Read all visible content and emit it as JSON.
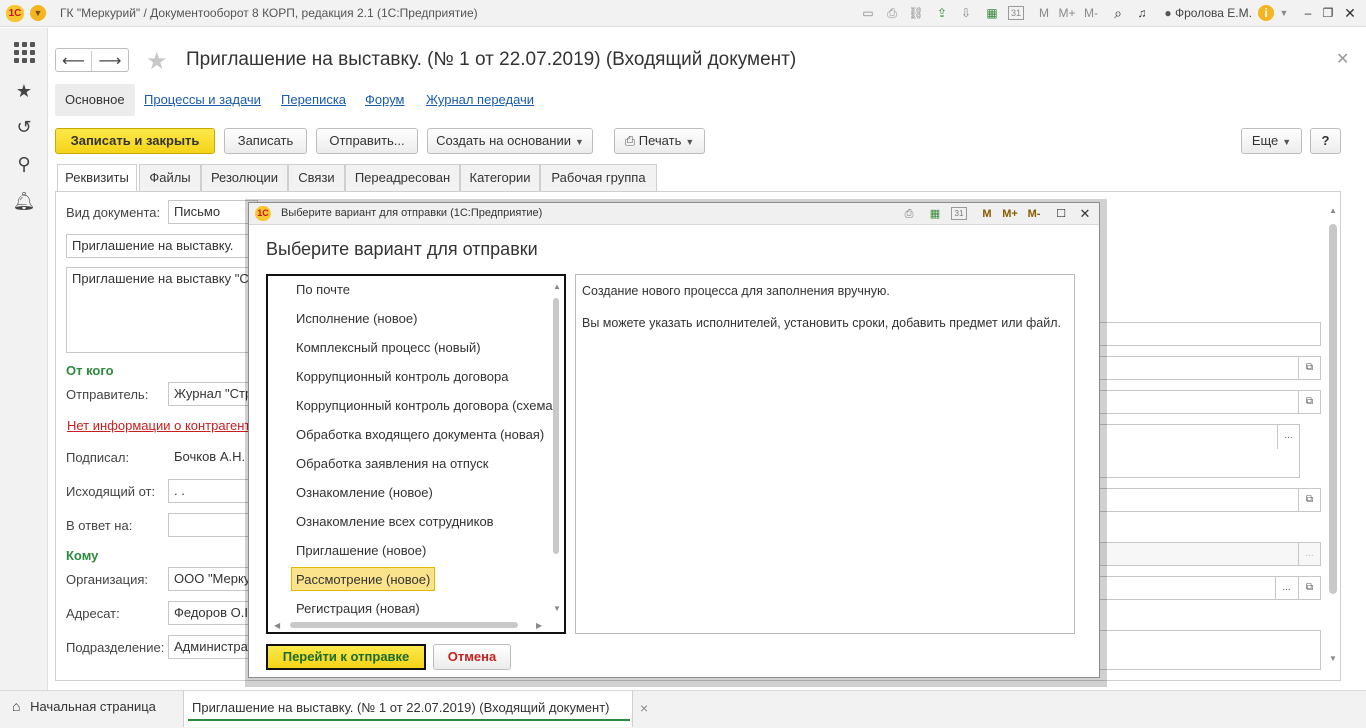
{
  "titlebar": {
    "logo": "1С",
    "title": "ГК \"Меркурий\" / Документооборот 8 КОРП, редакция 2.1  (1С:Предприятие)",
    "user": "Фролова Е.М.",
    "icons": [
      "save-icon",
      "print-icon",
      "link-icon",
      "upload-icon",
      "download-icon",
      "calculator-icon",
      "calendar-icon",
      "memory-m-icon",
      "memory-plus-icon",
      "memory-minus-icon",
      "search-icon",
      "bell-icon",
      "info-icon",
      "minimize-icon",
      "restore-icon",
      "close-icon"
    ],
    "calendar_day": "31",
    "m": "M",
    "mplus": "M+",
    "mminus": "M-"
  },
  "sidebar": {
    "icons": [
      "apps-grid-icon",
      "favorites-star-icon",
      "history-icon",
      "search-icon",
      "notifications-bell-icon"
    ]
  },
  "form": {
    "title": "Приглашение на выставку. (№ 1 от 22.07.2019) (Входящий документ)",
    "nav": {
      "main": "Основное",
      "links": [
        "Процессы и задачи",
        "Переписка",
        "Форум",
        "Журнал передачи"
      ]
    },
    "toolbar": {
      "save_close": "Записать и закрыть",
      "save": "Записать",
      "send": "Отправить...",
      "create_based": "Создать на основании",
      "print": "Печать",
      "more": "Еще",
      "help": "?"
    },
    "tabs": [
      "Реквизиты",
      "Файлы",
      "Резолюции",
      "Связи",
      "Переадресован",
      "Категории",
      "Рабочая группа"
    ],
    "fields": {
      "doc_type_label": "Вид документа:",
      "doc_type_value": "Письмо",
      "subject": "Приглашение на выставку.",
      "content": "Приглашение на выставку \"С",
      "from_group": "От кого",
      "sender_label": "Отправитель:",
      "sender_value": "Журнал \"Стр",
      "no_info_link": "Нет информации о контрагенте",
      "signed_label": "Подписал:",
      "signed_value": "Бочков А.Н.",
      "outgoing_label": "Исходящий от:",
      "outgoing_value": " .  .",
      "reply_label": "В ответ на:",
      "reply_value": "",
      "to_group": "Кому",
      "org_label": "Организация:",
      "org_value": "ООО \"Мерку",
      "addressee_label": "Адресат:",
      "addressee_value": "Федоров О.I",
      "dept_label": "Подразделение:",
      "dept_value": "Администрат"
    }
  },
  "dialog": {
    "window_title": "Выберите вариант для отправки  (1С:Предприятие)",
    "heading": "Выберите вариант для отправки",
    "items": [
      "По почте",
      "Исполнение (новое)",
      "Комплексный процесс (новый)",
      "Коррупционный контроль договора",
      "Коррупционный контроль договора (схема",
      "Обработка входящего документа (новая)",
      "Обработка заявления на отпуск",
      "Ознакомление (новое)",
      "Ознакомление всех сотрудников",
      "Приглашение (новое)",
      "Рассмотрение (новое)",
      "Регистрация (новая)"
    ],
    "selected_index": 10,
    "description_line1": "Создание нового процесса для заполнения вручную.",
    "description_line2": "Вы можете указать исполнителей, установить сроки, добавить предмет или файл.",
    "go_button": "Перейти к отправке",
    "cancel_button": "Отмена"
  },
  "taskbar": {
    "home": "Начальная страница",
    "doc_tab": "Приглашение на выставку. (№ 1 от 22.07.2019) (Входящий документ)",
    "close": "×"
  }
}
